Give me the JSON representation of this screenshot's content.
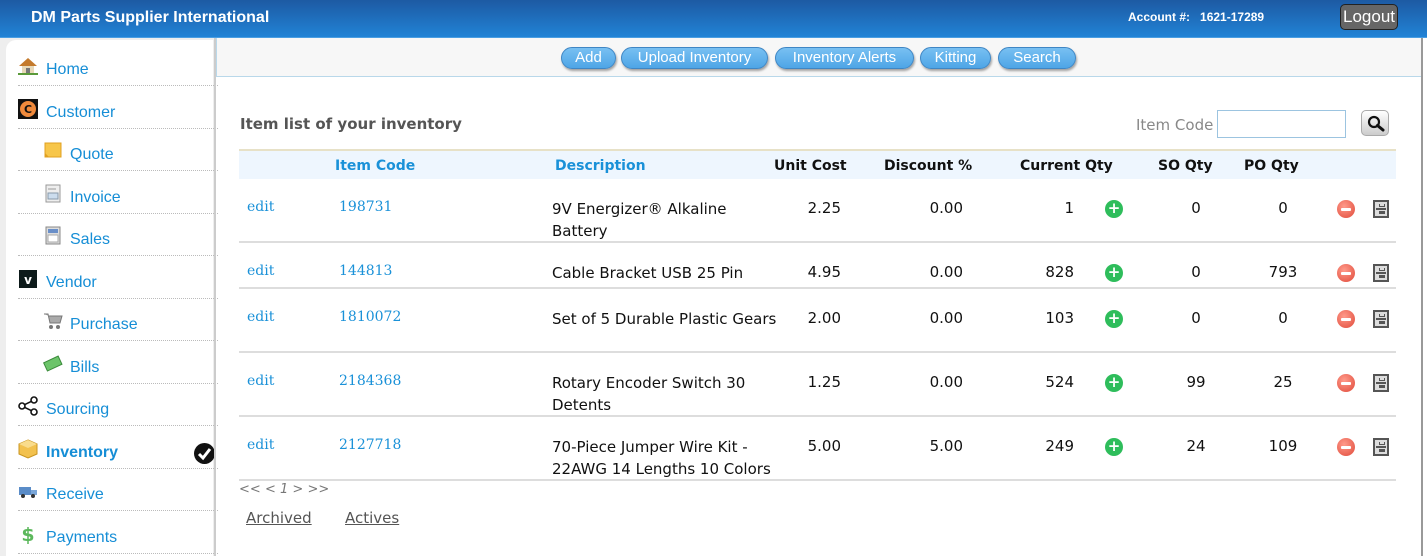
{
  "header": {
    "brand": "DM Parts Supplier International",
    "account_label": "Account #:",
    "account_number": "1621-17289",
    "logout_label": "Logout"
  },
  "sidebar": {
    "items": [
      {
        "label": "Home",
        "icon": "house-icon",
        "level": "top"
      },
      {
        "label": "Customer",
        "icon": "customer-c-icon",
        "level": "top"
      },
      {
        "label": "Quote",
        "icon": "note-icon",
        "level": "sub"
      },
      {
        "label": "Invoice",
        "icon": "invoice-sheet-icon",
        "level": "sub"
      },
      {
        "label": "Sales",
        "icon": "calculator-icon",
        "level": "sub"
      },
      {
        "label": "Vendor",
        "icon": "vendor-v-icon",
        "level": "top"
      },
      {
        "label": "Purchase",
        "icon": "cart-icon",
        "level": "sub"
      },
      {
        "label": "Bills",
        "icon": "money-icon",
        "level": "sub"
      },
      {
        "label": "Sourcing",
        "icon": "share-nodes-icon",
        "level": "top"
      },
      {
        "label": "Inventory",
        "icon": "box-icon",
        "level": "top",
        "active": true
      },
      {
        "label": "Receive",
        "icon": "truck-icon",
        "level": "top"
      },
      {
        "label": "Payments",
        "icon": "dollar-icon",
        "level": "top"
      }
    ]
  },
  "toolbar": {
    "buttons": [
      "Add",
      "Upload Inventory",
      "Inventory Alerts",
      "Kitting",
      "Search"
    ]
  },
  "main": {
    "title": "Item list of your inventory",
    "search": {
      "label": "Item Code",
      "value": "",
      "placeholder": ""
    },
    "columns": [
      "Item Code",
      "Description",
      "Unit Cost",
      "Discount %",
      "Current Qty",
      "SO Qty",
      "PO Qty"
    ],
    "edit_label": "edit",
    "rows": [
      {
        "code": "198731",
        "description": "9V Energizer® Alkaline Battery",
        "unit_cost": "2.25",
        "discount": "0.00",
        "current_qty": "1",
        "so_qty": "0",
        "po_qty": "0"
      },
      {
        "code": "144813",
        "description": "Cable Bracket USB 25 Pin",
        "unit_cost": "4.95",
        "discount": "0.00",
        "current_qty": "828",
        "so_qty": "0",
        "po_qty": "793"
      },
      {
        "code": "1810072",
        "description": "Set of 5 Durable Plastic Gears",
        "unit_cost": "2.00",
        "discount": "0.00",
        "current_qty": "103",
        "so_qty": "0",
        "po_qty": "0"
      },
      {
        "code": "2184368",
        "description": "Rotary Encoder Switch 30 Detents",
        "unit_cost": "1.25",
        "discount": "0.00",
        "current_qty": "524",
        "so_qty": "99",
        "po_qty": "25"
      },
      {
        "code": "2127718",
        "description": "70-Piece Jumper Wire Kit - 22AWG 14 Lengths 10 Colors",
        "unit_cost": "5.00",
        "discount": "5.00",
        "current_qty": "249",
        "so_qty": "24",
        "po_qty": "109"
      }
    ],
    "pager": {
      "first": "<<",
      "prev": "<",
      "page": "1",
      "next": ">",
      "last": ">>"
    },
    "links": {
      "archived": "Archived",
      "actives": "Actives"
    }
  },
  "colors": {
    "accent": "#1a91d8",
    "header_top": "#1d5aa3",
    "header_bottom": "#2183d6",
    "add_green": "#2ebd5b",
    "remove_red": "#e04a3a"
  }
}
